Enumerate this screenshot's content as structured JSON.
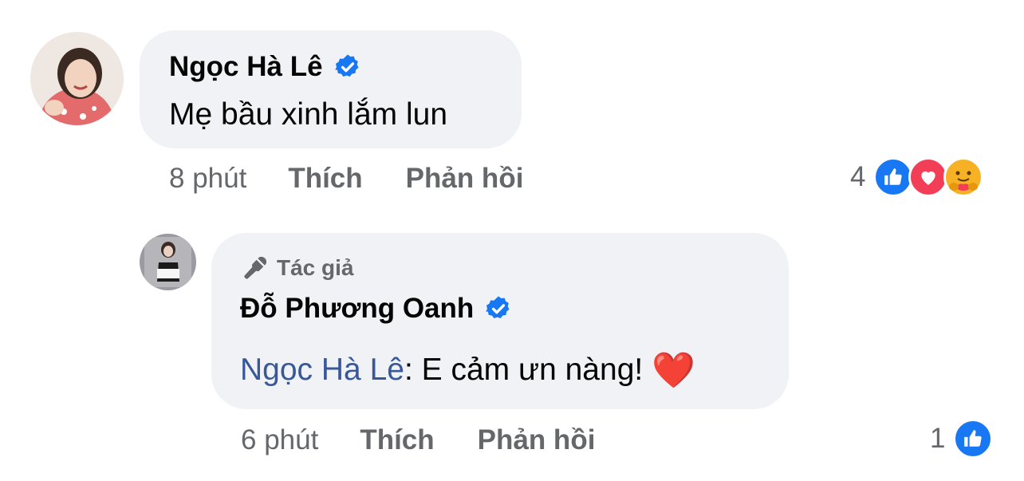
{
  "comment": {
    "author": "Ngọc Hà Lê",
    "text": "Mẹ bầu xinh lắm lun",
    "time": "8 phút",
    "like_label": "Thích",
    "reply_label": "Phản hồi",
    "reaction_count": "4",
    "reactions": [
      "like-icon",
      "love-icon",
      "care-icon"
    ]
  },
  "reply": {
    "badge": "Tác giả",
    "author": "Đỗ Phương Oanh",
    "mention": "Ngọc Hà Lê",
    "text": ": E cảm ưn nàng! ",
    "emoji": "❤️",
    "time": "6 phút",
    "like_label": "Thích",
    "reply_label": "Phản hồi",
    "reaction_count": "1",
    "reactions": [
      "like-icon"
    ]
  },
  "colors": {
    "bubble": "#f0f2f5",
    "verified": "#1877f2",
    "mention": "#385898",
    "secondary_text": "#65676b",
    "love": "#f33e58",
    "care": "#f7b125"
  }
}
